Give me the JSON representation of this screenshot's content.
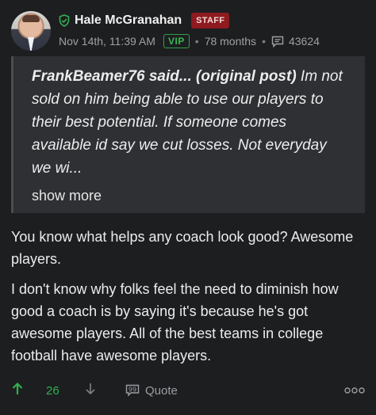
{
  "post": {
    "author": "Hale McGranahan",
    "staff_badge": "STAFF",
    "date": "Nov 14th, 11:39 AM",
    "vip_badge": "VIP",
    "tenure": "78 months",
    "post_count": "43624"
  },
  "quote": {
    "author_label": "FrankBeamer76 said... (original post)",
    "text": " Im not sold on him being able to use our players to their best potential. If someone comes available id say we cut losses. Not everyday we wi...",
    "show_more": "show more"
  },
  "body": {
    "paragraph_1": "You know what helps any coach look good? Awesome players.",
    "paragraph_2": "I don't know why folks feel the need to diminish how good a coach is by saying it's because he's got awesome players. All of the best teams in college football have awesome players."
  },
  "actions": {
    "vote_count": "26",
    "quote_label": "Quote"
  },
  "colors": {
    "background": "#1d1e20",
    "staff_badge": "#8d1b1f",
    "vip_green": "#2fa14b",
    "vote_green": "#2fb14e"
  },
  "icons": {
    "verified": "shield-check-icon",
    "posts": "comment-icon",
    "upvote": "arrow-up-icon",
    "downvote": "arrow-down-icon",
    "quote": "quote-icon",
    "more": "more-horizontal-icon"
  }
}
